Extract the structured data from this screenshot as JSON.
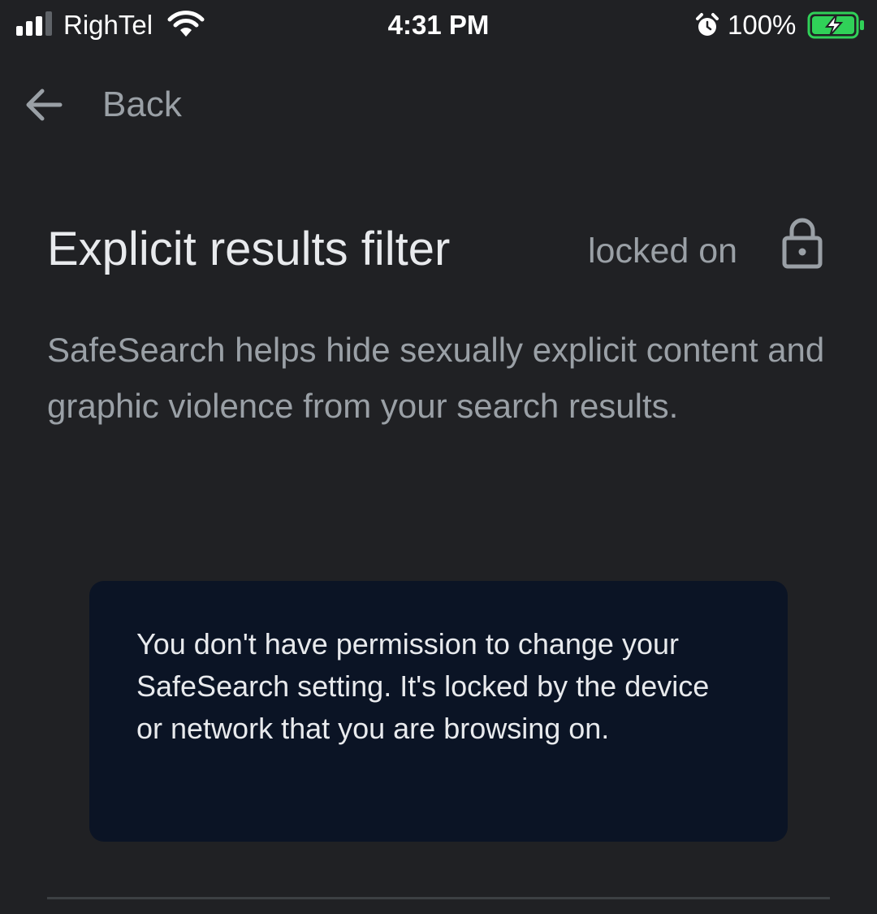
{
  "status_bar": {
    "carrier": "RighTel",
    "time": "4:31 PM",
    "battery_percent": "100%",
    "signal_bars_active": 3,
    "signal_bars_total": 4,
    "icons": [
      "signal-icon",
      "wifi-icon",
      "alarm-icon",
      "battery-charging-icon"
    ],
    "battery_color": "#30d158"
  },
  "nav": {
    "back_label": "Back",
    "back_icon": "arrow-left-icon"
  },
  "setting": {
    "title": "Explicit results filter",
    "status": "locked on",
    "status_icon": "lock-icon",
    "description": "SafeSearch helps hide sexually explicit content and graphic violence from your search results."
  },
  "notice": {
    "text": "You don't have permission to change your SafeSearch setting. It's locked by the device or network that you are browsing on."
  },
  "colors": {
    "background": "#202124",
    "primary_text": "#e8eaed",
    "secondary_text": "#9aa0a6",
    "notice_background": "#0b1425",
    "divider": "#3c4043"
  }
}
